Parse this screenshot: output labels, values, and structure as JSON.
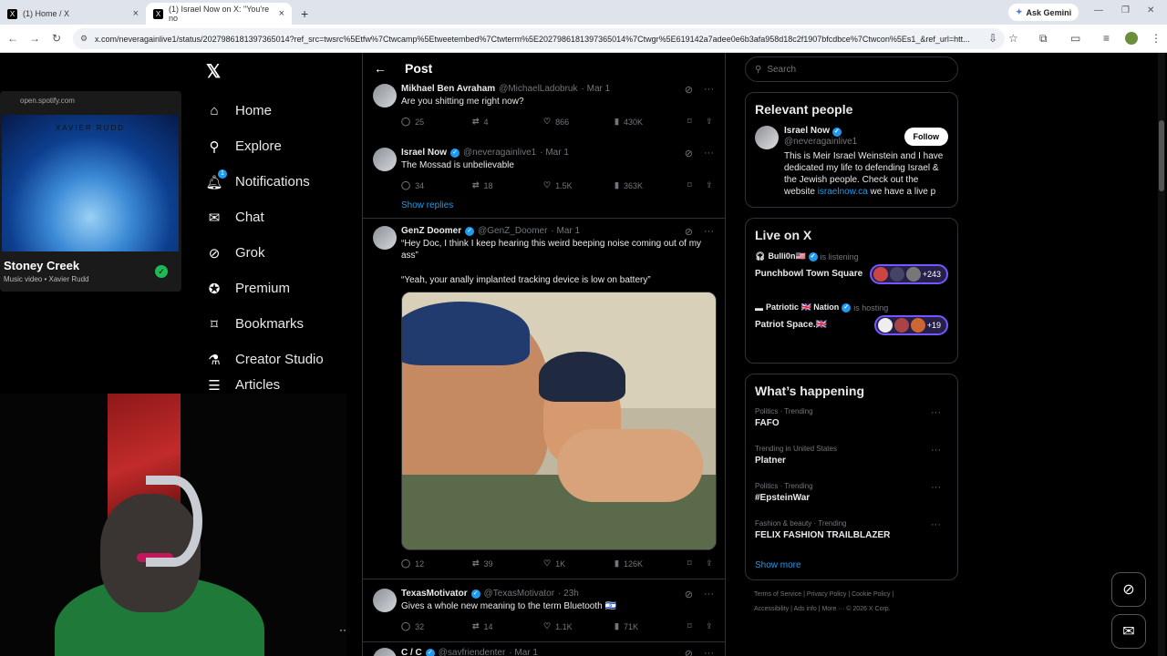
{
  "browser": {
    "tabs": [
      {
        "title": "(1) Home / X"
      },
      {
        "title": "(1) Israel Now on X: \"You're no"
      }
    ],
    "gemini_label": "Ask Gemini",
    "url": "x.com/neveragainlive1/status/2027986181397365014?ref_src=twsrc%5Etfw%7Ctwcamp%5Etweetembed%7Ctwterm%5E2027986181397365014%7Ctwgr%5E619142a7adee0e6b3afa958d18c2f1907bfcdbce%7Ctwcon%5Es1_&ref_url=htt..."
  },
  "spotify": {
    "source": "open.spotify.com",
    "album_text": "XAVIER RUDD",
    "track": "Stoney Creek",
    "subtitle": "Music video • Xavier Rudd"
  },
  "nav": {
    "items": [
      {
        "label": "Home",
        "icon": "home-icon"
      },
      {
        "label": "Explore",
        "icon": "search-icon"
      },
      {
        "label": "Notifications",
        "icon": "bell-icon",
        "badge": "1"
      },
      {
        "label": "Chat",
        "icon": "mail-icon"
      },
      {
        "label": "Grok",
        "icon": "grok-icon"
      },
      {
        "label": "Premium",
        "icon": "verified-icon"
      },
      {
        "label": "Bookmarks",
        "icon": "bookmark-icon"
      },
      {
        "label": "Creator Studio",
        "icon": "flask-icon"
      },
      {
        "label": "Articles",
        "icon": "article-icon"
      }
    ]
  },
  "post_header": {
    "title": "Post"
  },
  "tweets": [
    {
      "name": "Mikhael Ben Avraham",
      "handle": "@MichaelLadobruk",
      "date": "· Mar 1",
      "text": "Are you shitting me right now?",
      "replies": "25",
      "reposts": "4",
      "likes": "866",
      "views": "430K"
    },
    {
      "name": "Israel Now",
      "handle": "@neveragainlive1",
      "date": "· Mar 1",
      "text": "The Mossad is unbelievable",
      "replies": "34",
      "reposts": "18",
      "likes": "1.5K",
      "views": "363K"
    },
    {
      "name": "GenZ Doomer",
      "handle": "@GenZ_Doomer",
      "date": "· Mar 1",
      "text": "“Hey Doc, I think I keep hearing this weird beeping noise coming out of my ass”",
      "text2": "“Yeah, your anally implanted tracking device is low on battery”",
      "replies": "12",
      "reposts": "39",
      "likes": "1K",
      "views": "126K"
    },
    {
      "name": "TexasMotivator",
      "handle": "@TexasMotivator",
      "date": "· 23h",
      "text": "Gives a whole new meaning to the term Bluetooth 🇮🇱",
      "replies": "32",
      "reposts": "14",
      "likes": "1.1K",
      "views": "71K"
    },
    {
      "name": "C / C",
      "handle": "@savfriendenter",
      "date": "· Mar 1"
    }
  ],
  "show_replies": "Show replies",
  "right": {
    "search_placeholder": "Search",
    "relevant_title": "Relevant people",
    "person": {
      "name": "Israel Now",
      "handle": "@neveragainlive1",
      "follow": "Follow",
      "bio": "This is Meir Israel Weinstein and I have dedicated my life to defending Israel & the Jewish people. Check out the website ",
      "bio_link": "israelnow.ca",
      "bio_end": " we have a live p"
    },
    "live_title": "Live on X",
    "live": [
      {
        "host": "Bulli0n🇺🇸",
        "role": "is listening",
        "space": "Punchbowl Town Square",
        "count": "+243"
      },
      {
        "host": "Patriotic 🇬🇧 Nation",
        "role": "is hosting",
        "space": "Patriot Space.🇬🇧",
        "count": "+19"
      }
    ],
    "happening_title": "What’s happening",
    "trends": [
      {
        "category": "Politics · Trending",
        "name": "FAFO"
      },
      {
        "category": "Trending in United States",
        "name": "Platner"
      },
      {
        "category": "Politics · Trending",
        "name": "#EpsteinWar"
      },
      {
        "category": "Fashion & beauty · Trending",
        "name": "FELIX FASHION TRAILBLAZER"
      }
    ],
    "show_more": "Show more",
    "footer": {
      "line1": "Terms of Service  |  Privacy Policy  |  Cookie Policy  |",
      "line2": "Accessibility  |  Ads info  |  More ···  © 2026 X Corp."
    }
  },
  "colors": {
    "accent": "#1d9bf0",
    "background": "#000000",
    "spotify_green": "#1db954"
  }
}
